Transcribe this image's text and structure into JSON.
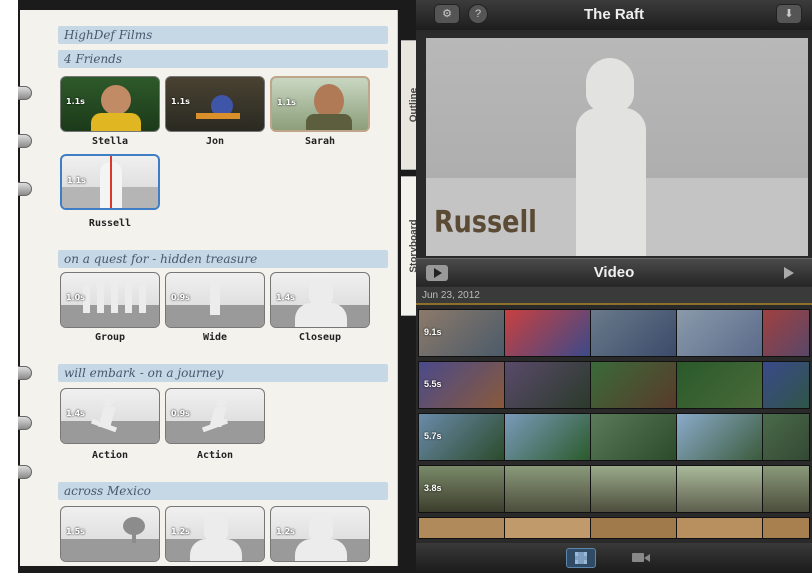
{
  "app": {
    "project_title": "The Raft",
    "tabs": {
      "outline": "Outline",
      "storyboard": "Storyboard"
    }
  },
  "notebook": {
    "sections": [
      {
        "header": "HighDef Films"
      },
      {
        "header": "4 Friends",
        "clips": [
          {
            "duration": "1.1s",
            "label": "Stella"
          },
          {
            "duration": "1.1s",
            "label": "Jon"
          },
          {
            "duration": "1.1s",
            "label": "Sarah"
          },
          {
            "duration": "1.1s",
            "label": "Russell",
            "selected": true
          }
        ]
      },
      {
        "header": "on a quest for - hidden treasure",
        "clips": [
          {
            "duration": "1.0s",
            "label": "Group"
          },
          {
            "duration": "0.9s",
            "label": "Wide"
          },
          {
            "duration": "1.4s",
            "label": "Closeup"
          }
        ]
      },
      {
        "header": "will embark - on a journey",
        "clips": [
          {
            "duration": "1.4s",
            "label": "Action"
          },
          {
            "duration": "0.9s",
            "label": "Action"
          }
        ]
      },
      {
        "header": "across Mexico",
        "clips": [
          {
            "duration": "1.5s",
            "label": ""
          },
          {
            "duration": "1.2s",
            "label": ""
          },
          {
            "duration": "1.2s",
            "label": ""
          }
        ]
      }
    ]
  },
  "viewer": {
    "title": "Russell"
  },
  "browser": {
    "title": "Video",
    "date": "Jun 23, 2012",
    "strips": [
      {
        "duration": "9.1s"
      },
      {
        "duration": "5.5s"
      },
      {
        "duration": "5.7s"
      },
      {
        "duration": "3.8s"
      }
    ]
  },
  "colors": {
    "accent": "#3f7ec4",
    "header_band": "#c6d7e6",
    "playhead": "#d83a2e"
  }
}
